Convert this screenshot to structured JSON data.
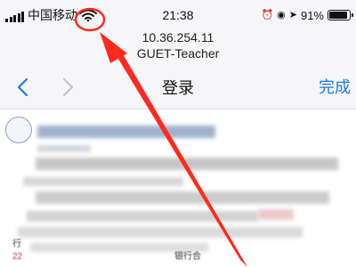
{
  "status_bar": {
    "carrier": "中国移动",
    "time": "21:38",
    "battery": "91%",
    "battery_level": 0.91,
    "icons": [
      "signal-icon",
      "wifi-icon",
      "alarm-icon",
      "rotation-lock-icon",
      "location-icon",
      "battery-icon"
    ]
  },
  "host": {
    "ip": "10.36.254.11",
    "ssid": "GUET-Teacher"
  },
  "nav": {
    "title": "登录",
    "done_label": "完成",
    "icons": [
      "back-icon",
      "forward-icon"
    ]
  },
  "web_content": {
    "footer_left": "行",
    "footer_number": "22",
    "footer_right": "银行合"
  },
  "annotation": {
    "color": "#ff2a1f",
    "icons": [
      "highlight-circle",
      "arrow-icon"
    ]
  },
  "colors": {
    "accent": "#1a7ae8",
    "bar_background": "#f6f6f8",
    "annotation": "#ff2a1f"
  }
}
